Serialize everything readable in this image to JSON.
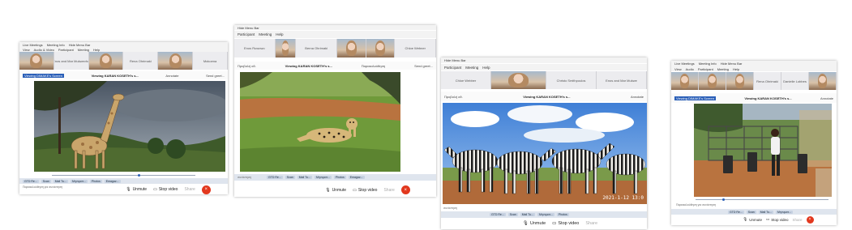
{
  "shots": [
    {
      "menu": [
        "Live Meetings",
        "Meeting Info",
        "Hide Menu Bar"
      ],
      "menu2": [
        "View",
        "Audio & Video",
        "Participant",
        "Meeting",
        "Help"
      ],
      "participants": [
        "",
        "Enos and Mar Mukwevho",
        "",
        "Rena Ohrimaki",
        "",
        "Mokoena"
      ],
      "share_left": "Viewing DIMAKE's Screen",
      "share_center": "Viewing KARAN KOSETH's s...",
      "share_right1": "Annotate",
      "share_right2": "Send greet...",
      "controls": {
        "unmute": "Unmute",
        "stop_video": "Stop video",
        "share": "Share"
      },
      "status": "Παρακολούθηση για συνάντηση"
    },
    {
      "menu": [
        "Hide Menu Bar"
      ],
      "menu2": [
        "Participant",
        "Meeting",
        "Help"
      ],
      "participants": [
        "Enos Ruwowo",
        "",
        "Berna Ohrimaki",
        "",
        "",
        "Chloe Webner"
      ],
      "share_left": "Προβολή οθ.",
      "share_center": "Viewing KARAN KOSETH's s...",
      "share_right1": "Παρακολούθηση",
      "share_right2": "Send greet...",
      "controls": {
        "unmute": "Unmute",
        "stop_video": "Stop video",
        "share": "Share"
      },
      "status": "συνάντηση"
    },
    {
      "menu": [
        "Hide Menu Bar"
      ],
      "menu2": [
        "Participant",
        "Meeting",
        "Help"
      ],
      "participants": [
        "Chloe Webber",
        "",
        "Christo Smithpoulos",
        "Enos and Mar Mukwe"
      ],
      "share_left": "Προβολή οθ.",
      "share_center": "Viewing KARAN KOSETH's s...",
      "share_right1": "Annotate",
      "timestamp": "2021-1-12 13:0",
      "controls": {
        "unmute": "Unmute",
        "stop_video": "Stop video",
        "share": "Share"
      },
      "status": "συνάντηση"
    },
    {
      "menu": [
        "Live Meetings",
        "Meeting Info",
        "Hide Menu Bar"
      ],
      "menu2": [
        "View",
        "Audio",
        "Participant",
        "Meeting",
        "Help"
      ],
      "participants": [
        "",
        "",
        "",
        "Rena Ohrimaki",
        "Danielle Lobbes",
        ""
      ],
      "share_left": "Viewing DIMAKE's Screen",
      "share_center": "Viewing KARAN KOSETH's s...",
      "share_right1": "Annotate",
      "controls": {
        "unmute": "Unmute",
        "stop_video": "Stop video",
        "share": "Share"
      },
      "status": "Παρακολούθηση για συνάντηση"
    }
  ],
  "taskbar_items": [
    "GTD Re...",
    "Scan",
    "Mail Tu...",
    "Μηνυματ...",
    "Photos",
    "Emagaz..."
  ],
  "colors": {
    "end_button": "#e2381e",
    "sky": "#7fb0e6",
    "grass": "#6f9a3a",
    "dirt": "#b9733f"
  }
}
